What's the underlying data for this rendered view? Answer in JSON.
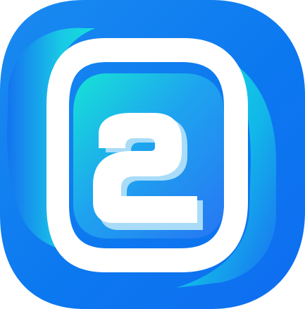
{
  "logo": {
    "name": "app-icon-2",
    "glyph": "2",
    "colors": {
      "background": "#ffffff",
      "blue": "#1f6ff2",
      "cyan": "#14e0d8",
      "inner_blue": "#2a7bf2",
      "shadow_blue": "#0e5bd8",
      "white": "#ffffff"
    }
  }
}
